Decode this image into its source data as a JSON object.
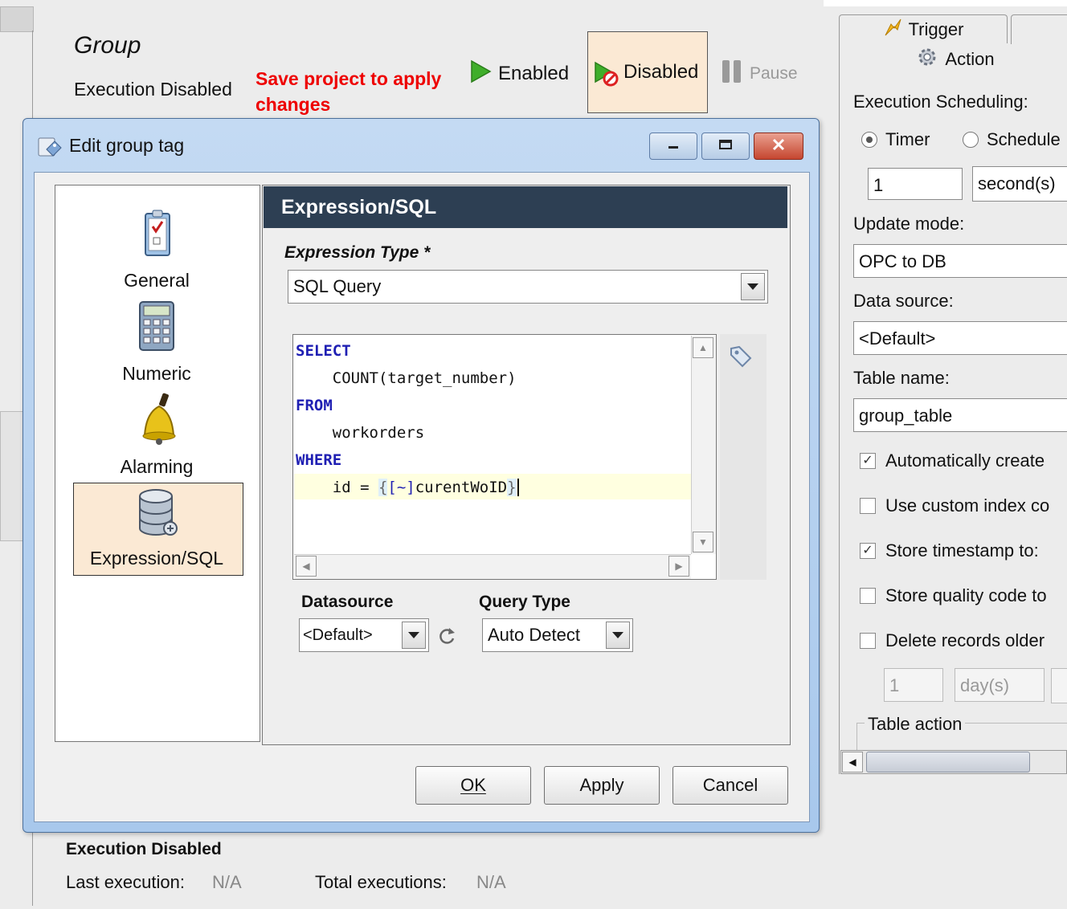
{
  "background": {
    "group_title": "Group",
    "execution_status": "Execution Disabled",
    "save_message": "Save project to apply changes",
    "enabled_label": "Enabled",
    "disabled_label": "Disabled",
    "pause_label": "Pause",
    "status_title": "Execution Disabled",
    "last_execution_label": "Last execution:",
    "last_execution_value": "N/A",
    "total_executions_label": "Total executions:",
    "total_executions_value": "N/A"
  },
  "right_panel": {
    "tabs": {
      "trigger": "Trigger",
      "action": "Action"
    },
    "execution_scheduling_label": "Execution Scheduling:",
    "timer_label": "Timer",
    "schedule_label": "Schedule",
    "rate_value": "1",
    "rate_unit": "second(s)",
    "update_mode_label": "Update mode:",
    "update_mode_value": "OPC to DB",
    "data_source_label": "Data source:",
    "data_source_value": "<Default>",
    "table_name_label": "Table name:",
    "table_name_value": "group_table",
    "auto_create_label": "Automatically create",
    "custom_index_label": "Use custom index co",
    "store_timestamp_label": "Store timestamp to:",
    "store_quality_label": "Store quality code to",
    "delete_records_label": "Delete records older",
    "delete_age_value": "1",
    "delete_age_unit": "day(s)",
    "table_action_label": "Table action"
  },
  "dialog": {
    "title": "Edit group tag",
    "nav": [
      {
        "label": "General"
      },
      {
        "label": "Numeric"
      },
      {
        "label": "Alarming"
      },
      {
        "label": "Expression/SQL"
      }
    ],
    "section_title": "Expression/SQL",
    "expression_type_label": "Expression Type *",
    "expression_type_value": "SQL Query",
    "code": {
      "l1": "SELECT",
      "l2": "    COUNT(target_number)",
      "l3": "FROM",
      "l4": "    workorders",
      "l5": "WHERE",
      "l6_prefix": "    id = ",
      "l6_open": "{",
      "l6_ref": "[~]",
      "l6_name": "curentWoID",
      "l6_close": "}"
    },
    "datasource_label": "Datasource",
    "datasource_value": "<Default>",
    "query_type_label": "Query Type",
    "query_type_value": "Auto Detect",
    "ok_label": "OK",
    "apply_label": "Apply",
    "cancel_label": "Cancel"
  }
}
